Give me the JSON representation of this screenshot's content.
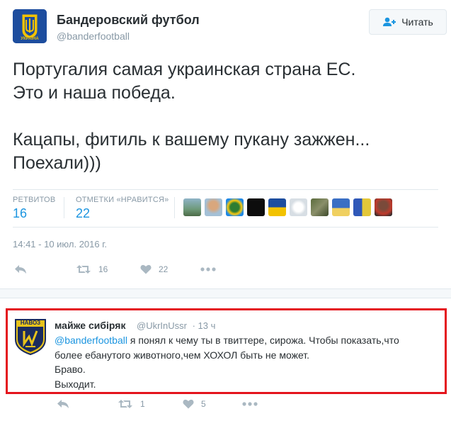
{
  "tweet": {
    "author_name": "Бандеровский футбол",
    "author_handle": "@banderfootball",
    "avatar_text": "УКРАЇНА",
    "follow_label": "Читать",
    "text_lines": [
      "Португалия самая украинская страна ЕС.",
      "Это и наша победа.",
      "",
      "Кацапы, фитиль к вашему пукану зажжен...",
      "Поехали)))"
    ],
    "stats": {
      "retweets_label": "РЕТВИТОВ",
      "retweets_count": "16",
      "likes_label": "ОТМЕТКИ «НРАВИТСЯ»",
      "likes_count": "22"
    },
    "timestamp": "14:41 - 10 июл. 2016 г.",
    "actions": {
      "retweet_count": "16",
      "like_count": "22"
    }
  },
  "reply": {
    "author_name": "майже сибіряк",
    "author_handle": "@UkrInUssr",
    "time": "· 13 ч",
    "avatar_text": "НАВОЗ",
    "mention": "@banderfootball",
    "line1_rest": " я понял к чему ты в твиттере, сирожа. Чтобы показать,что",
    "line2": "более ебанутого животного,чем ХОХОЛ быть не может.",
    "line3": "Браво.",
    "line4": "Выходит.",
    "actions": {
      "retweet_count": "1",
      "like_count": "5"
    }
  },
  "colors": {
    "link": "#1b95e0",
    "muted": "#8899a6",
    "highlight_border": "#e4141d"
  }
}
